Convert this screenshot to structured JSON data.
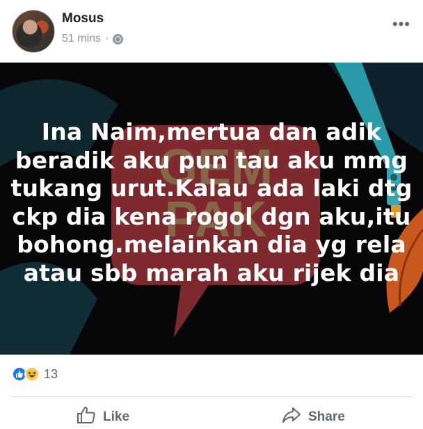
{
  "post": {
    "author": "Mosus",
    "time": "51 mins",
    "separator": "·",
    "more_icon": "more-options-icon",
    "image_text_lines": [
      "Ina Naim,mertua dan adik",
      "beradik aku pun tau aku mmg",
      "tukang urut.Kalau ada laki dtg",
      "ckp dia kena rogol dgn aku,itu",
      "bohong.melainkan dia yg rela",
      "atau sbb marah aku rijek dia"
    ],
    "watermark": "GEMPAK"
  },
  "reactions": {
    "icons": [
      "like-reaction-icon",
      "haha-reaction-icon"
    ],
    "count": "13"
  },
  "actions": {
    "like_label": "Like",
    "share_label": "Share"
  },
  "colors": {
    "like_blue": "#1877f2",
    "haha_yellow": "#f7c948",
    "text_gray": "#606770"
  }
}
